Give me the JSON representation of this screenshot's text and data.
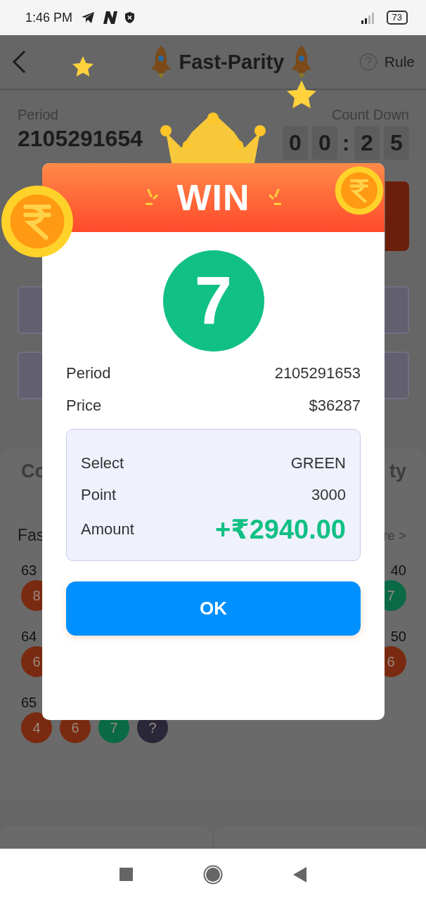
{
  "status_bar": {
    "time": "1:46 PM",
    "battery": "73"
  },
  "header": {
    "title": "Fast-Parity",
    "rule": "Rule"
  },
  "period": {
    "label": "Period",
    "value": "2105291654"
  },
  "countdown": {
    "label": "Count Down",
    "digits": [
      "0",
      "0",
      ":",
      "2",
      "5"
    ]
  },
  "section": {
    "title_left": "Co",
    "title_right": "ty",
    "subtitle_left": "Fas",
    "more": "re >"
  },
  "records": {
    "left": [
      {
        "period": "63",
        "balls": [
          {
            "label": "8",
            "color": "#7a2a10"
          }
        ]
      },
      {
        "period": "64",
        "balls": [
          {
            "label": "6",
            "color": "#7a2a10"
          }
        ]
      },
      {
        "period": "65",
        "balls": [
          {
            "label": "4",
            "color": "#7a2a10"
          },
          {
            "label": "6",
            "color": "#7a2a10"
          },
          {
            "label": "7",
            "color": "#0a6a45"
          },
          {
            "label": "?",
            "color": "#2a2838"
          }
        ]
      }
    ],
    "right": [
      {
        "period": "40",
        "balls": [
          {
            "label": "7",
            "color": "#0a6a45"
          }
        ]
      },
      {
        "period": "50",
        "balls": [
          {
            "label": "6",
            "color": "#7a2a10"
          }
        ]
      }
    ]
  },
  "dialog": {
    "title": "WIN",
    "number": "7",
    "rows": [
      {
        "label": "Period",
        "value": "2105291653"
      },
      {
        "label": "Price",
        "value": "$36287"
      }
    ],
    "bet": [
      {
        "label": "Select",
        "value": "GREEN",
        "kind": "plain"
      },
      {
        "label": "Point",
        "value": "3000",
        "kind": "plain"
      },
      {
        "label": "Amount",
        "value": "+₹2940.00",
        "kind": "amount"
      }
    ],
    "button": "OK"
  }
}
